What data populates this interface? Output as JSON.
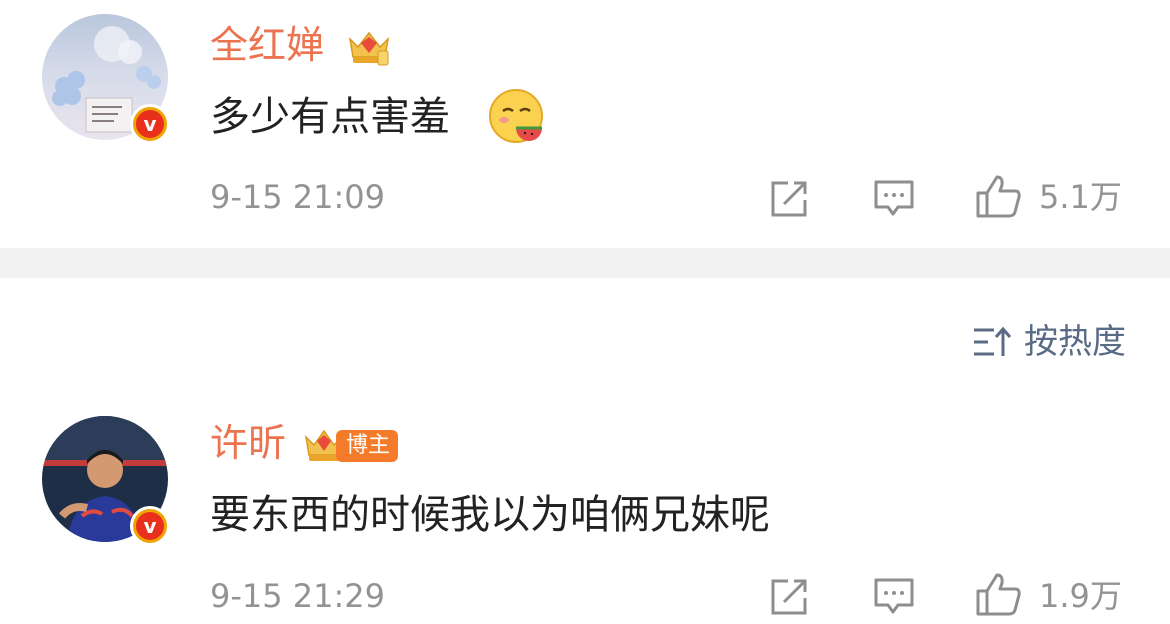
{
  "comments": [
    {
      "username": "全红婵",
      "text": "多少有点害羞",
      "emoji": "shy-melon-emoji",
      "time": "9-15 21:09",
      "likes": "5.1万",
      "badge": ""
    },
    {
      "username": "许昕",
      "text": "要东西的时候我以为咱俩兄妹呢",
      "emoji": "",
      "time": "9-15 21:29",
      "likes": "1.9万",
      "badge": "博主"
    }
  ],
  "sort": {
    "label": "按热度",
    "icon": "sort-icon"
  },
  "icons": {
    "share": "share-icon",
    "comment": "comment-icon",
    "like": "thumbs-up-icon",
    "verified": "verified-v-icon",
    "crown": "crown-icon"
  },
  "colors": {
    "username": "#eb7350",
    "text": "#222222",
    "meta": "#939393",
    "divider": "#f2f2f2",
    "sort": "#5a6b85",
    "verified": "#e8301c"
  }
}
